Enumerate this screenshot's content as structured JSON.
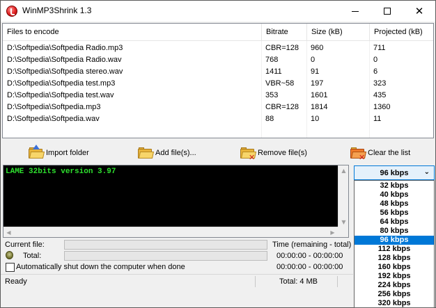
{
  "window": {
    "title": "WinMP3Shrink 1.3",
    "minimize": "minimize",
    "maximize": "maximize",
    "close": "close"
  },
  "file_list": {
    "columns": [
      "Files to encode",
      "Bitrate",
      "Size (kB)",
      "Projected (kB)"
    ],
    "rows": [
      [
        "D:\\Softpedia\\Softpedia Radio.mp3",
        "CBR=128",
        "960",
        "711"
      ],
      [
        "D:\\Softpedia\\Softpedia Radio.wav",
        "768",
        "0",
        "0"
      ],
      [
        "D:\\Softpedia\\Softpedia stereo.wav",
        "1411",
        "91",
        "6"
      ],
      [
        "D:\\Softpedia\\Softpedia test.mp3",
        "VBR~58",
        "197",
        "323"
      ],
      [
        "D:\\Softpedia\\Softpedia test.wav",
        "353",
        "1601",
        "435"
      ],
      [
        "D:\\Softpedia\\Softpedia.mp3",
        "CBR=128",
        "1814",
        "1360"
      ],
      [
        "D:\\Softpedia\\Softpedia.wav",
        "88",
        "10",
        "11"
      ]
    ]
  },
  "toolbar": {
    "import_folder": "Import folder",
    "add_files": "Add file(s)...",
    "remove_files": "Remove file(s)",
    "clear_list": "Clear the list"
  },
  "console": {
    "text": "LAME 32bits version 3.97"
  },
  "bitrate": {
    "selected": "96 kbps",
    "options": [
      "32 kbps",
      "40 kbps",
      "48 kbps",
      "56 kbps",
      "64 kbps",
      "80 kbps",
      "96 kbps",
      "112 kbps",
      "128 kbps",
      "160 kbps",
      "192 kbps",
      "224 kbps",
      "256 kbps",
      "320 kbps"
    ],
    "selected_index": 6
  },
  "progress": {
    "current_file_label": "Current file:",
    "total_label": "Total:",
    "time_header": "Time (remaining - total)",
    "current_time": "00:00:00 - 00:00:00",
    "total_time": "00:00:00 - 00:00:00",
    "current_fraction": 0,
    "total_fraction": 0
  },
  "shutdown": {
    "label": "Automatically shut down the computer when done",
    "checked": false
  },
  "status": {
    "state": "Ready",
    "total": "Total: 4 MB"
  },
  "colors": {
    "console_bg": "#000000",
    "console_text": "#2ee02e",
    "selection": "#0078d7"
  }
}
